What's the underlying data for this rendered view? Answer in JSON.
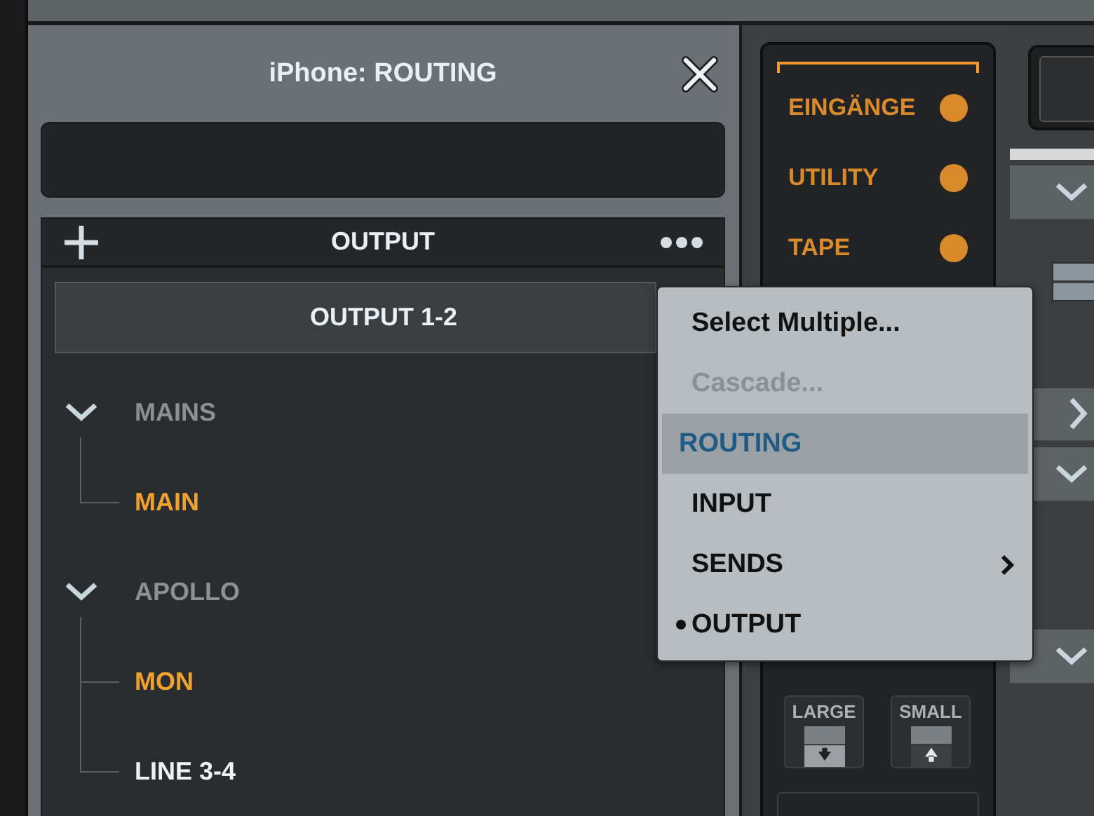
{
  "panel": {
    "title": "iPhone: ROUTING"
  },
  "section": {
    "title": "OUTPUT"
  },
  "output_button": "OUTPUT 1-2",
  "tree": [
    {
      "label": "MAINS",
      "expanded": true,
      "children": [
        {
          "label": "MAIN",
          "active": true
        }
      ]
    },
    {
      "label": "APOLLO",
      "expanded": true,
      "children": [
        {
          "label": "MON",
          "active": true
        },
        {
          "label": "LINE 3-4",
          "active": false
        }
      ]
    }
  ],
  "categories": [
    {
      "label": "EINGÄNGE",
      "on": true
    },
    {
      "label": "UTILITY",
      "on": true
    },
    {
      "label": "TAPE",
      "on": true
    }
  ],
  "size_buttons": [
    {
      "label": "LARGE",
      "kind": "down"
    },
    {
      "label": "SMALL",
      "kind": "up"
    }
  ],
  "side_sections": [
    {
      "expanded": true
    },
    {
      "expanded": false
    },
    {
      "expanded": true
    },
    {
      "expanded": true
    }
  ],
  "menu": [
    {
      "label": "Select Multiple...",
      "disabled": false,
      "selected": false,
      "checked": false,
      "submenu": false
    },
    {
      "label": "Cascade...",
      "disabled": true,
      "selected": false,
      "checked": false,
      "submenu": false
    },
    {
      "label": "ROUTING",
      "disabled": false,
      "selected": true,
      "checked": false,
      "submenu": false
    },
    {
      "label": "INPUT",
      "disabled": false,
      "selected": false,
      "checked": false,
      "submenu": false
    },
    {
      "label": "SENDS",
      "disabled": false,
      "selected": false,
      "checked": false,
      "submenu": true
    },
    {
      "label": "OUTPUT",
      "disabled": false,
      "selected": false,
      "checked": true,
      "submenu": false
    }
  ]
}
